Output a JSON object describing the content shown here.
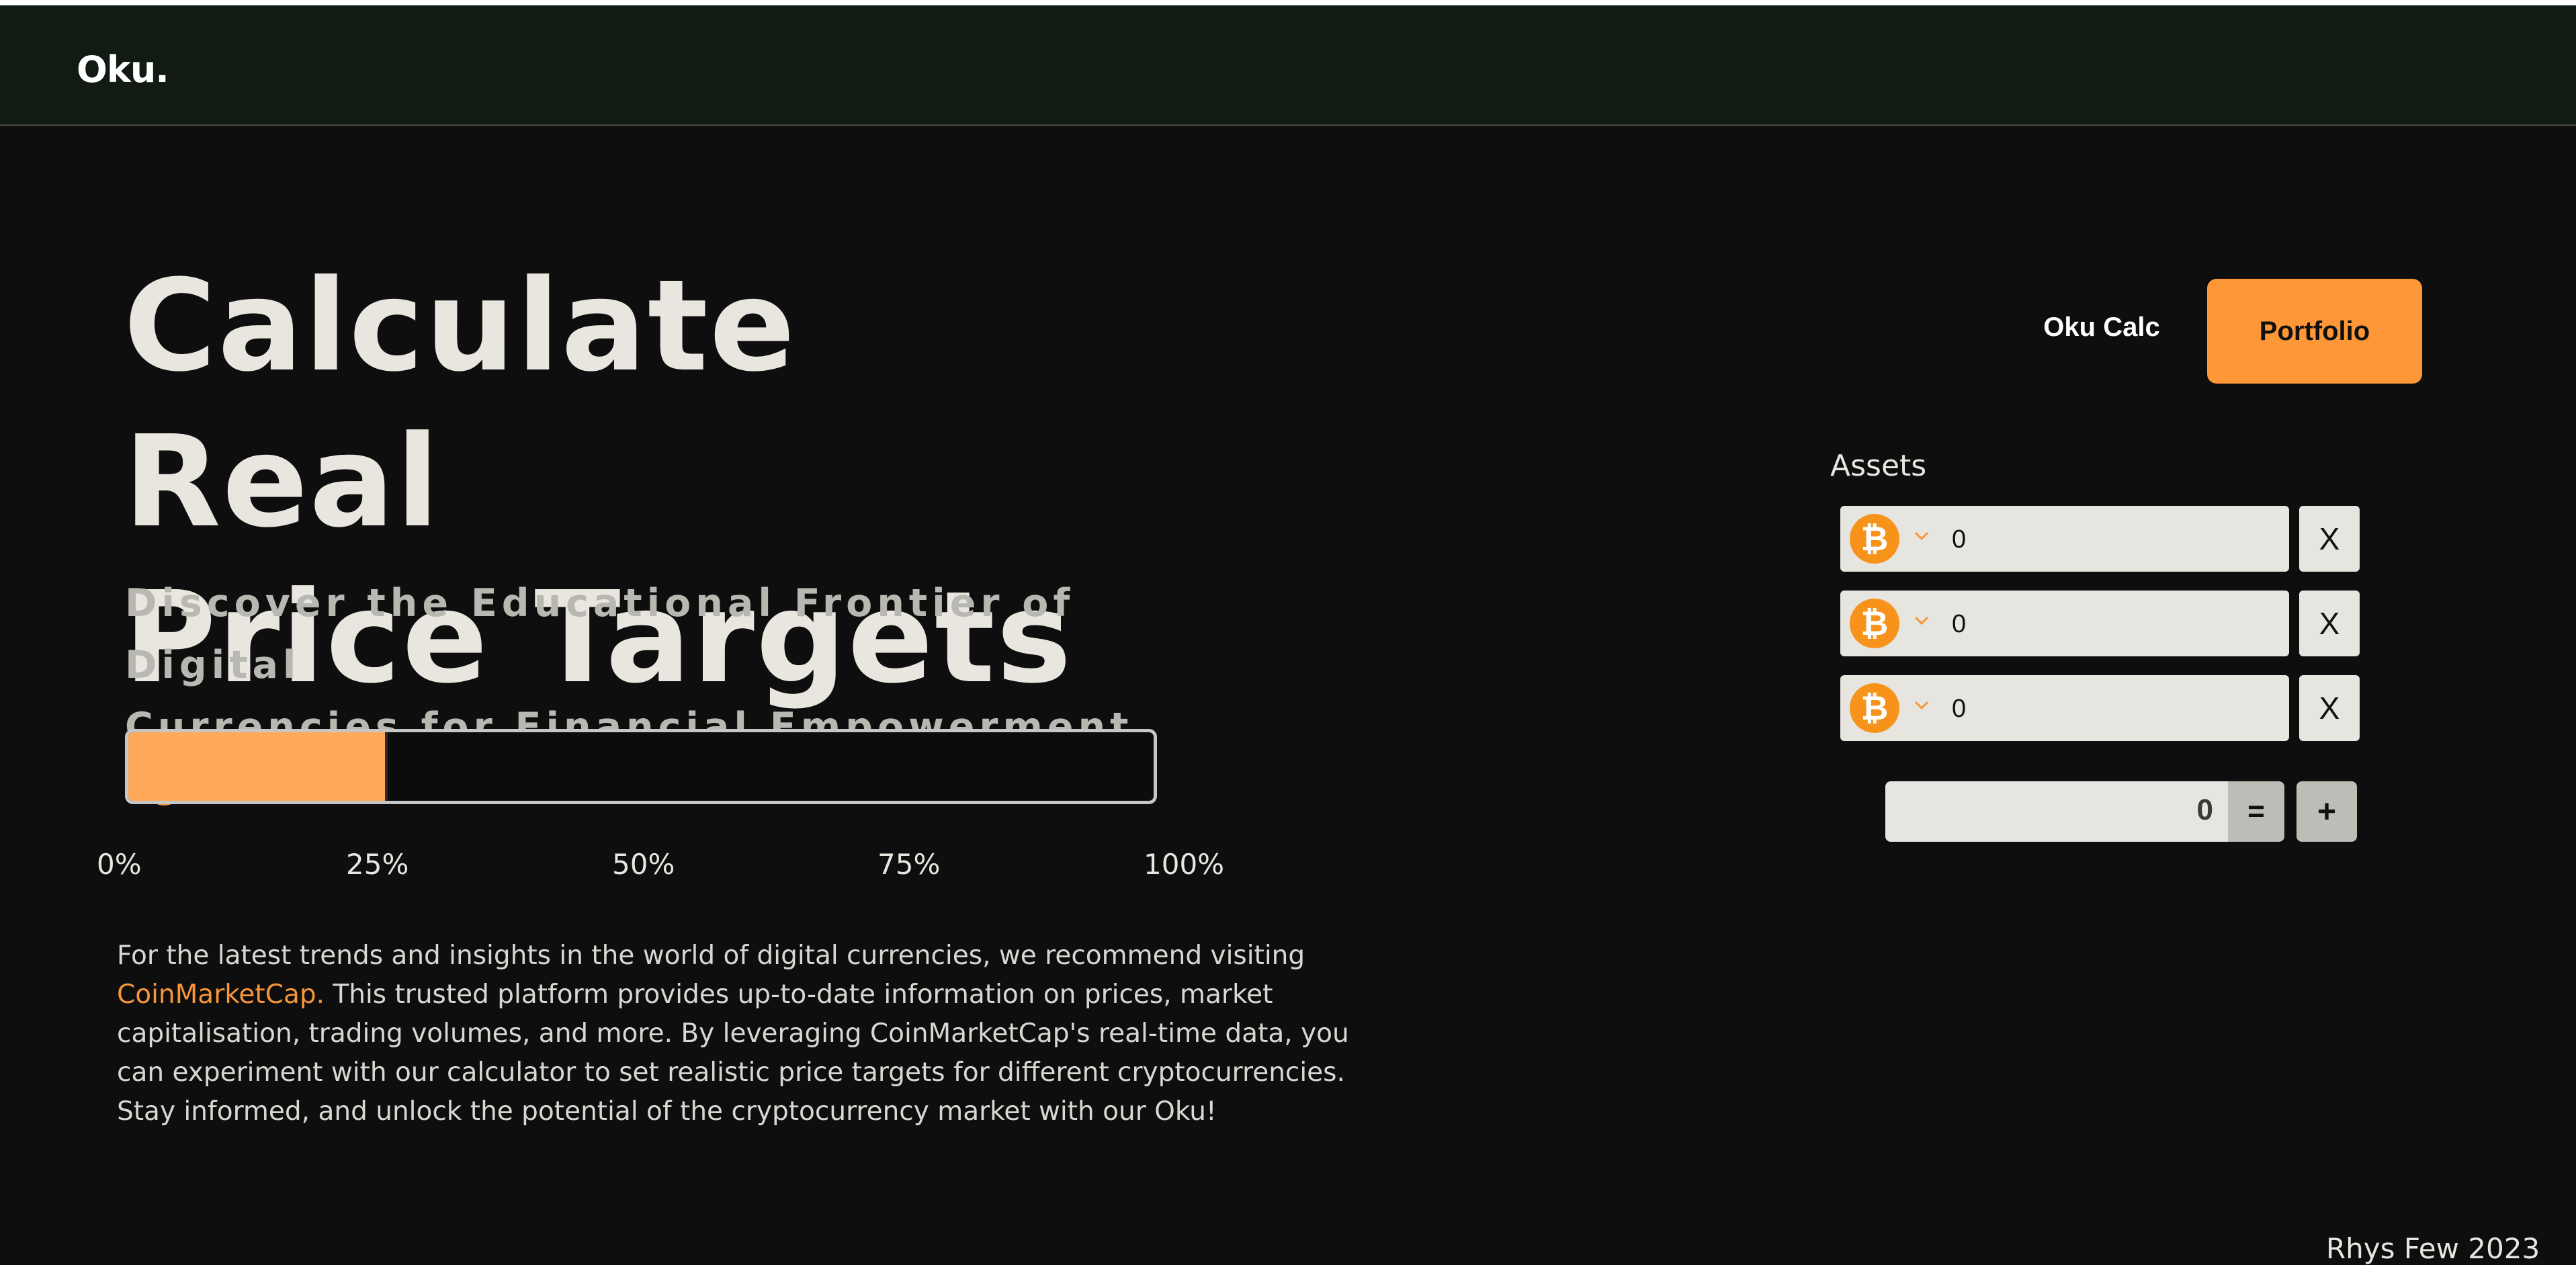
{
  "header": {
    "logo": "Oku."
  },
  "hero": {
    "title_line1": "Calculate Real",
    "title_line2": "Price Targets",
    "subtitle_line1": "Discover the Educational Frontier of Digital",
    "subtitle_line2": "Currencies for Financial Empowerment.",
    "help_icon": "question-circle-icon"
  },
  "progress": {
    "value_percent": 25,
    "ticks": [
      "0%",
      "25%",
      "50%",
      "75%",
      "100%"
    ]
  },
  "info": {
    "text_before_link": "For the latest trends and insights in the world of digital currencies, we recommend visiting ",
    "link_text": "CoinMarketCap.",
    "text_after_link": " This trusted platform provides up-to-date information on prices, market capitalisation, trading volumes, and more. By leveraging CoinMarketCap's real-time data, you can experiment with our calculator to set realistic price targets for different cryptocurrencies. Stay informed, and unlock the potential of the cryptocurrency market with our Oku!"
  },
  "nav": {
    "calc_label": "Oku Calc",
    "portfolio_label": "Portfolio"
  },
  "calculator": {
    "assets_label": "Assets",
    "rows": [
      {
        "coin_icon": "bitcoin-icon",
        "coin_glyph": "₿",
        "value": "0",
        "remove_label": "X"
      },
      {
        "coin_icon": "bitcoin-icon",
        "coin_glyph": "₿",
        "value": "0",
        "remove_label": "X"
      },
      {
        "coin_icon": "bitcoin-icon",
        "coin_glyph": "₿",
        "value": "0",
        "remove_label": "X"
      }
    ],
    "total": "0",
    "equals_label": "=",
    "add_label": "+"
  },
  "footer": {
    "credit": "Rhys Few 2023"
  },
  "colors": {
    "accent": "#fd9737",
    "progress_fill": "#ffa95a",
    "background": "#0e0e0e",
    "navbar": "#121a14",
    "field": "#e6e5df"
  }
}
